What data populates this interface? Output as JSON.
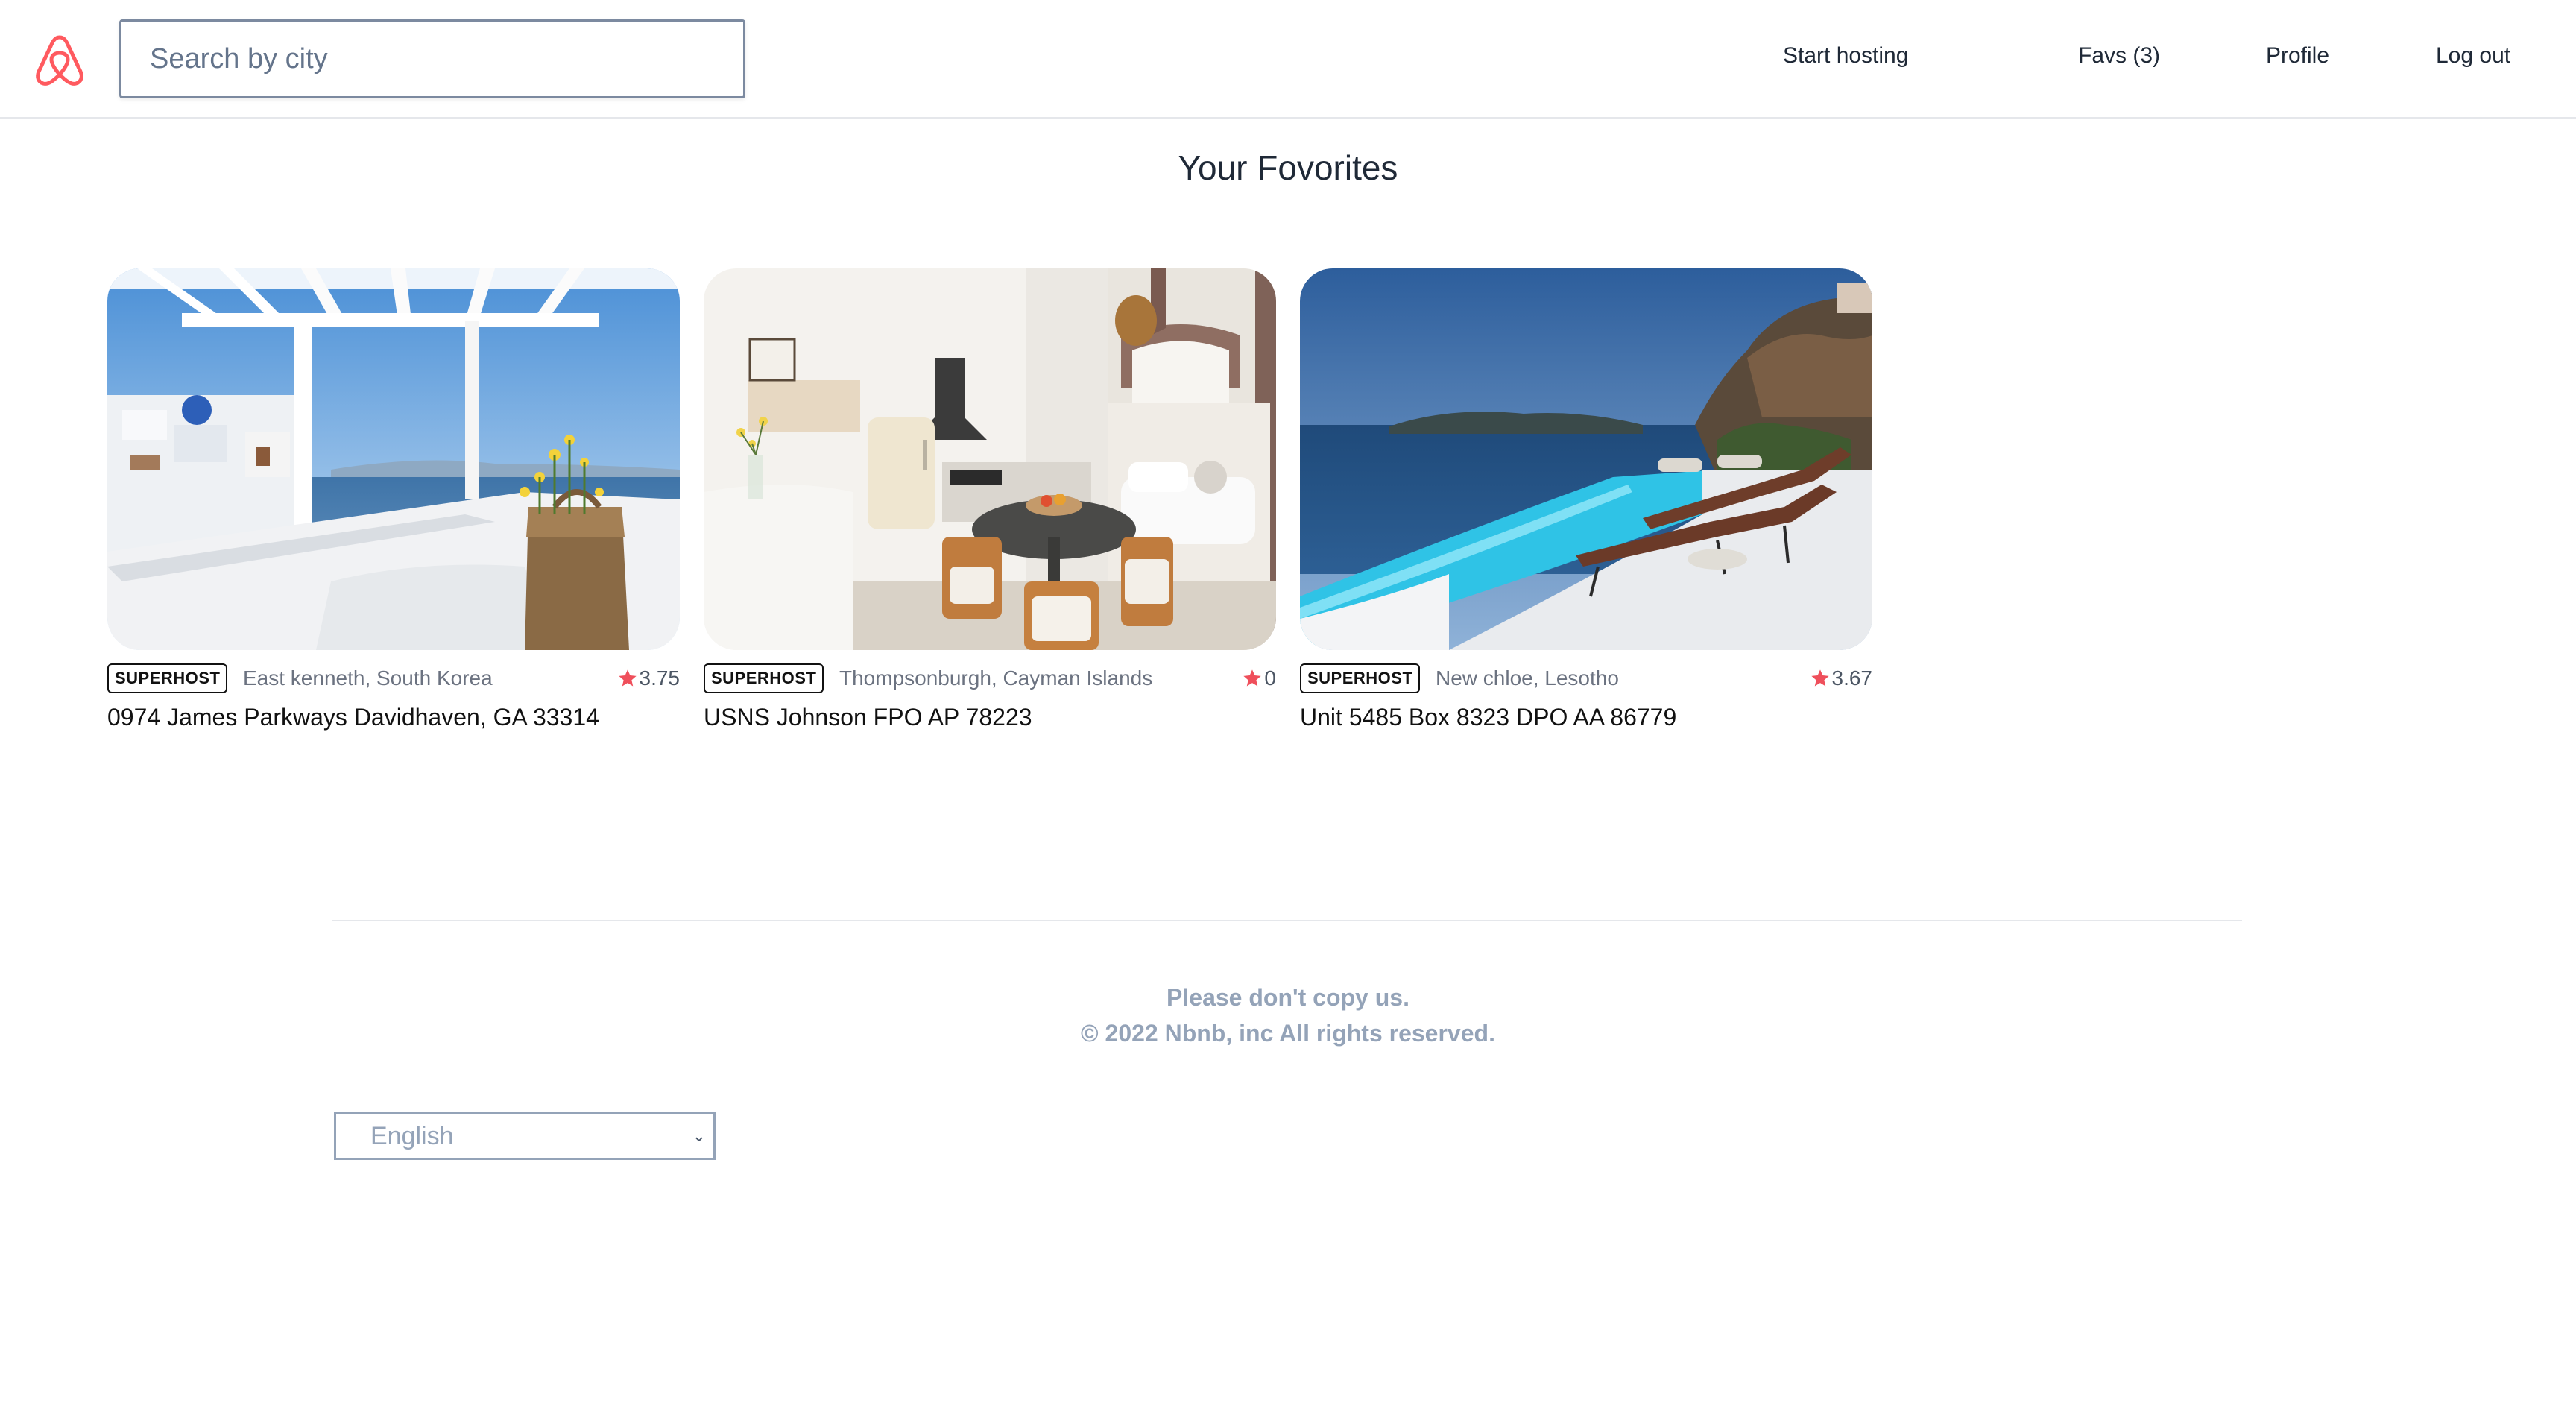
{
  "header": {
    "logo_name": "airbnb-logo",
    "brand_color": "#ff5a5f",
    "search": {
      "placeholder": "Search by city",
      "value": ""
    },
    "nav": {
      "start_hosting": "Start hosting",
      "favs": "Favs (3)",
      "profile": "Profile",
      "logout": "Log out"
    }
  },
  "main": {
    "title": "Your Fovorites",
    "listings": [
      {
        "badge": "SUPERHOST",
        "location": "East kenneth, South Korea",
        "rating": "3.75",
        "address": "0974 James Parkways Davidhaven, GA 33314",
        "image": "santorini-balcony-photo"
      },
      {
        "badge": "SUPERHOST",
        "location": "Thompsonburgh, Cayman Islands",
        "rating": "0",
        "address": "USNS Johnson FPO AP 78223",
        "image": "cave-kitchen-photo"
      },
      {
        "badge": "SUPERHOST",
        "location": "New chloe, Lesotho",
        "rating": "3.67",
        "address": "Unit 5485 Box 8323 DPO AA 86779",
        "image": "infinity-pool-photo"
      }
    ]
  },
  "footer": {
    "line1": "Please don't copy us.",
    "line2": "© 2022 Nbnb, inc All rights reserved.",
    "language": "English"
  }
}
